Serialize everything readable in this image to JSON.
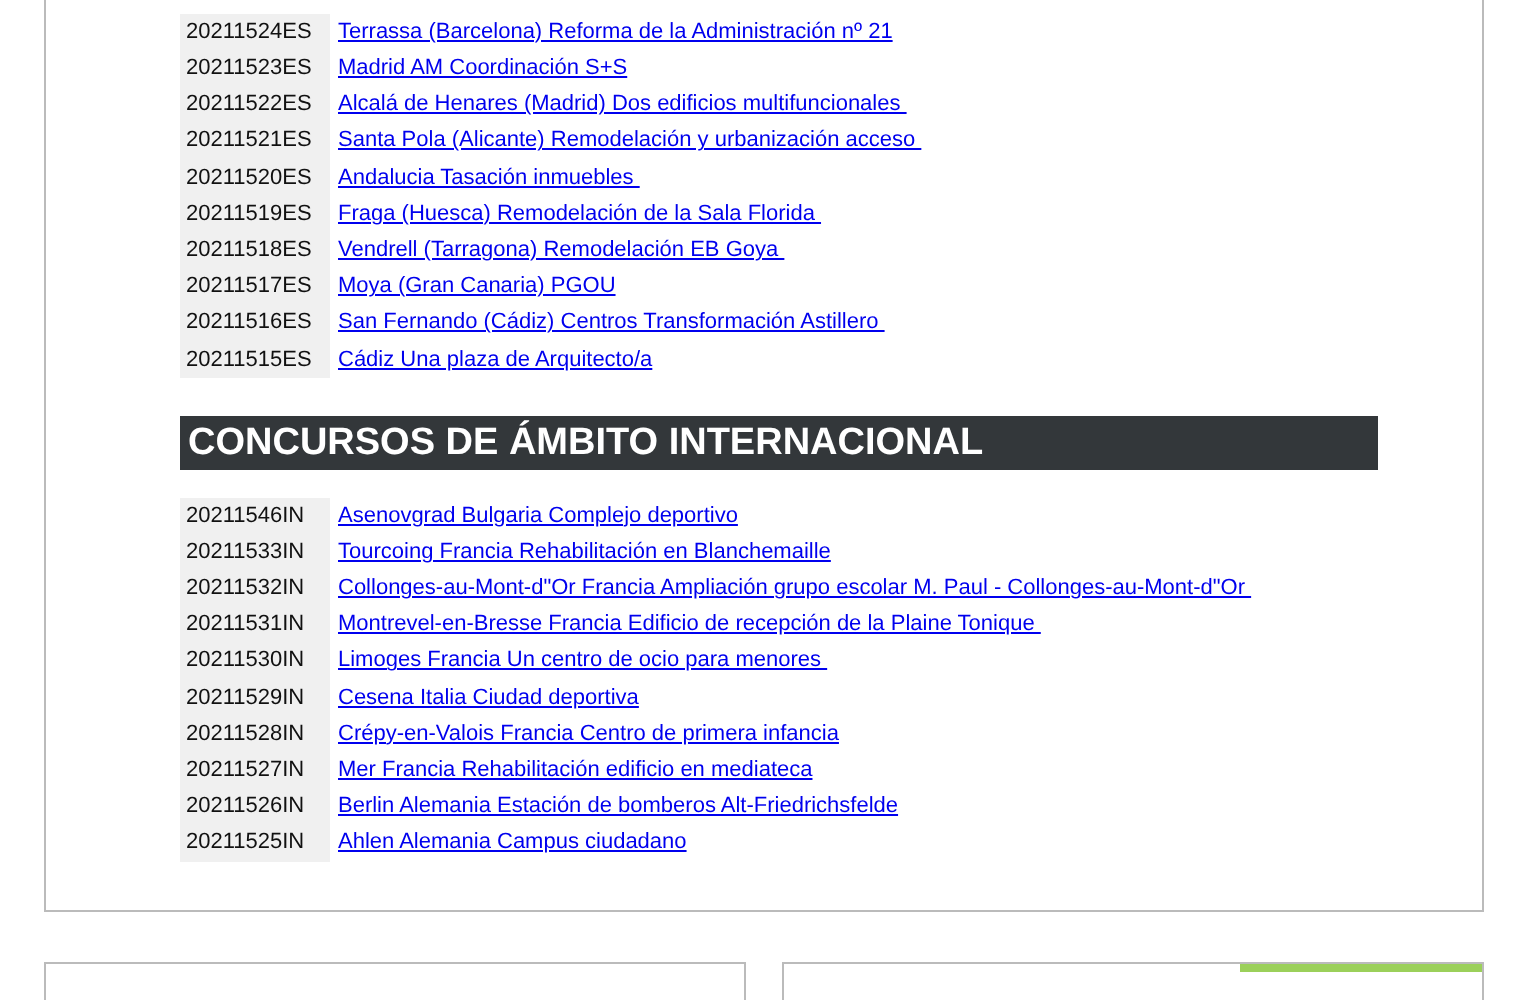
{
  "sections": [
    {
      "rows": [
        {
          "code": "20211524ES",
          "title": "Terrassa (Barcelona) Reforma de la Administración nº 21"
        },
        {
          "code": "20211523ES",
          "title": "Madrid AM Coordinación S+S"
        },
        {
          "code": "20211522ES",
          "title": "Alcalá de Henares (Madrid) Dos edificios multifuncionales "
        },
        {
          "code": "20211521ES",
          "title": "Santa Pola (Alicante) Remodelación y urbanización acceso "
        },
        {
          "code": "20211520ES",
          "title": "Andalucia Tasación inmuebles "
        },
        {
          "code": "20211519ES",
          "title": "Fraga (Huesca) Remodelación de la Sala Florida "
        },
        {
          "code": "20211518ES",
          "title": "Vendrell (Tarragona) Remodelación EB Goya "
        },
        {
          "code": "20211517ES",
          "title": "Moya (Gran Canaria) PGOU"
        },
        {
          "code": "20211516ES",
          "title": "San Fernando (Cádiz) Centros Transformación Astillero "
        },
        {
          "code": "20211515ES",
          "title": "Cádiz Una plaza de Arquitecto/a"
        }
      ]
    },
    {
      "title": "CONCURSOS DE ÁMBITO INTERNACIONAL",
      "rows": [
        {
          "code": "20211546IN",
          "title": "Asenovgrad Bulgaria Complejo deportivo"
        },
        {
          "code": "20211533IN",
          "title": "Tourcoing Francia Rehabilitación en Blanchemaille"
        },
        {
          "code": "20211532IN",
          "title": "Collonges-au-Mont-d\"Or Francia Ampliación grupo escolar M. Paul - Collonges-au-Mont-d\"Or "
        },
        {
          "code": "20211531IN",
          "title": "Montrevel-en-Bresse Francia Edificio de recepción de la Plaine Tonique "
        },
        {
          "code": "20211530IN",
          "title": "Limoges Francia Un centro de ocio para menores "
        },
        {
          "code": "20211529IN",
          "title": "Cesena Italia Ciudad deportiva"
        },
        {
          "code": "20211528IN",
          "title": "Crépy-en-Valois Francia Centro de primera infancia"
        },
        {
          "code": "20211527IN",
          "title": "Mer Francia Rehabilitación edificio en mediateca"
        },
        {
          "code": "20211526IN",
          "title": "Berlin Alemania Estación de bomberos Alt-Friedrichsfelde"
        },
        {
          "code": "20211525IN",
          "title": "Ahlen Alemania Campus ciudadano"
        }
      ]
    }
  ]
}
